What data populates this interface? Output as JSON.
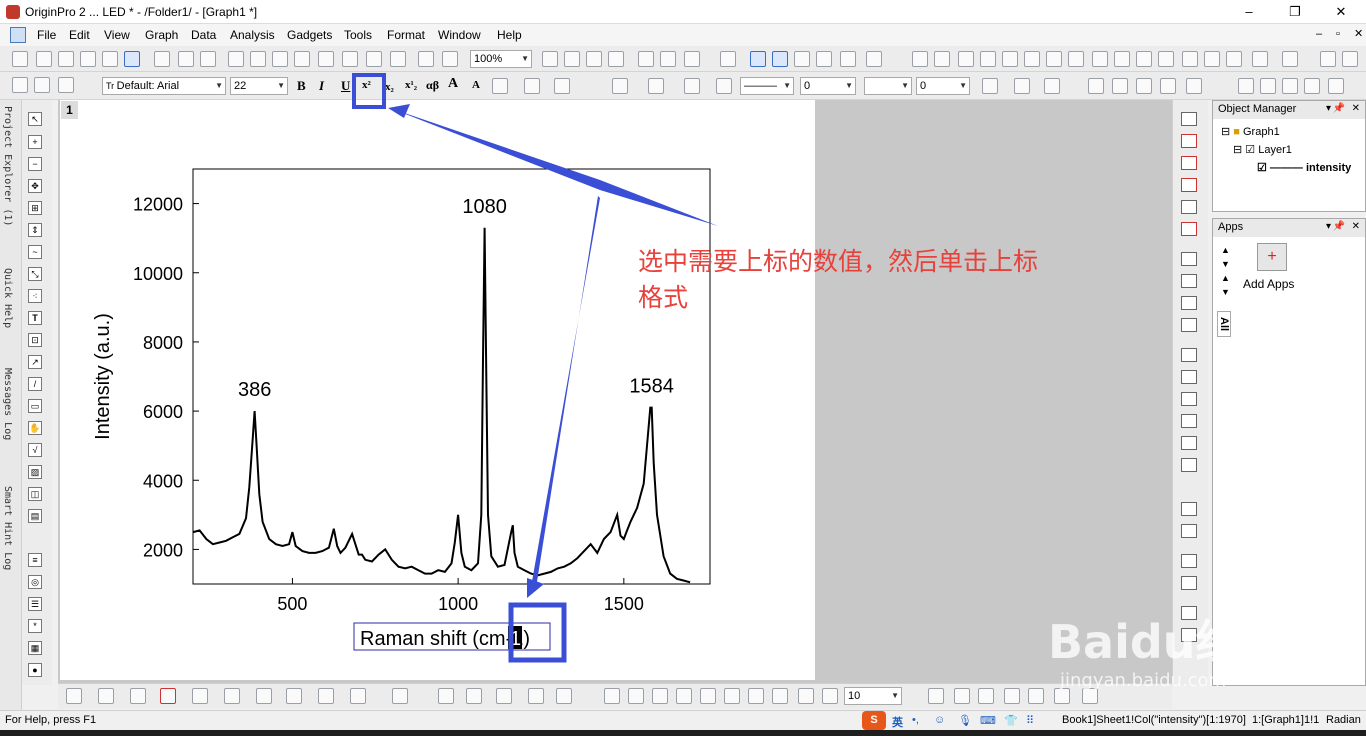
{
  "window": {
    "title": "OriginPro 2 ... LED * - /Folder1/ - [Graph1 *]",
    "controls": [
      "–",
      "❐",
      "✕"
    ]
  },
  "menu": [
    "File",
    "Edit",
    "View",
    "Graph",
    "Data",
    "Analysis",
    "Gadgets",
    "Tools",
    "Format",
    "Window",
    "Help"
  ],
  "toolbar": {
    "zoom": "100%",
    "font_name": "Default: Arial",
    "font_size": "22",
    "bold": "B",
    "italic": "I",
    "underline": "U",
    "superscript": "x²",
    "subscript": "x₂",
    "supersub": "x¹₂",
    "greek": "αβ",
    "increase_font": "A",
    "decrease_font": "A",
    "line_width": "0",
    "border_width": "0",
    "pattern_size": "10"
  },
  "side_tabs": [
    "Project Explorer (1)",
    "Quick Help",
    "Messages Log",
    "Smart Hint Log"
  ],
  "graph": {
    "page_number": "1",
    "colors": {
      "line": "#000000",
      "annotation": "#e8413b",
      "highlight_box": "#3b4fd6"
    }
  },
  "chart_data": {
    "type": "line",
    "xlabel": "Raman shift (cm-1)",
    "ylabel": "Intensity (a.u.)",
    "xlim": [
      200,
      1760
    ],
    "ylim": [
      1000,
      13000
    ],
    "xticks": [
      500,
      1000,
      1500
    ],
    "yticks": [
      2000,
      4000,
      6000,
      8000,
      10000,
      12000
    ],
    "xtick_labels": [
      "500",
      "1000",
      "1500"
    ],
    "ytick_labels": [
      "2000",
      "4000",
      "6000",
      "8000",
      "10000",
      "12000"
    ],
    "annotations": [
      {
        "text": "386",
        "x": 386,
        "y": 6200
      },
      {
        "text": "1080",
        "x": 1080,
        "y": 11500
      },
      {
        "text": "1584",
        "x": 1584,
        "y": 6300
      }
    ],
    "series": [
      {
        "x": [
          200,
          220,
          240,
          260,
          280,
          300,
          320,
          340,
          360,
          370,
          380,
          386,
          392,
          400,
          410,
          430,
          450,
          470,
          490,
          500,
          510,
          530,
          550,
          570,
          590,
          610,
          625,
          635,
          645,
          660,
          680,
          700,
          710,
          720,
          740,
          760,
          780,
          800,
          820,
          840,
          860,
          880,
          900,
          920,
          940,
          960,
          980,
          990,
          1000,
          1010,
          1020,
          1040,
          1060,
          1070,
          1075,
          1080,
          1085,
          1090,
          1100,
          1120,
          1140,
          1160,
          1165,
          1170,
          1180,
          1200,
          1220,
          1240,
          1260,
          1280,
          1300,
          1320,
          1340,
          1360,
          1380,
          1400,
          1420,
          1440,
          1460,
          1480,
          1490,
          1500,
          1510,
          1520,
          1540,
          1560,
          1570,
          1580,
          1584,
          1590,
          1600,
          1620,
          1640,
          1660,
          1680,
          1700
        ],
        "y": [
          2500,
          2550,
          2300,
          2150,
          2200,
          2250,
          2350,
          2450,
          2900,
          3800,
          5200,
          6000,
          5000,
          3600,
          2800,
          2300,
          2150,
          2100,
          2150,
          2500,
          2100,
          1950,
          1900,
          1900,
          1950,
          2050,
          2600,
          2100,
          1900,
          2050,
          2450,
          1850,
          1850,
          1700,
          1650,
          1850,
          2000,
          1700,
          1500,
          1450,
          1500,
          1400,
          1300,
          1300,
          1400,
          1350,
          1600,
          2200,
          3000,
          1900,
          1500,
          1400,
          1600,
          3000,
          7500,
          11300,
          7000,
          3000,
          1800,
          1500,
          1550,
          2500,
          2700,
          1900,
          1500,
          1400,
          1300,
          1250,
          1300,
          1350,
          1450,
          1500,
          1600,
          1750,
          1950,
          2150,
          1900,
          2300,
          2500,
          3000,
          2400,
          2300,
          2550,
          2800,
          3200,
          3900,
          5000,
          6100,
          6100,
          4500,
          3000,
          1800,
          1300,
          1150,
          1100,
          1050
        ]
      }
    ]
  },
  "callout": {
    "text_line1": "选中需要上标的数值，然后单击上标",
    "text_line2": "格式",
    "selected_text": "1"
  },
  "object_manager": {
    "title": "Object Manager",
    "tree": [
      "Graph1",
      "Layer1",
      "intensity"
    ]
  },
  "apps": {
    "title": "Apps",
    "tab": "All",
    "add_apps": "Add Apps"
  },
  "status": {
    "help": "For Help, press F1",
    "ime": "英",
    "sheet": "Book1]Sheet1!Col(\"intensity\")[1:1970]",
    "layer": "1:[Graph1]1!1",
    "angle": "Radian"
  },
  "watermark": {
    "brand": "Baidu经验",
    "url": "jingyan.baidu.com"
  }
}
